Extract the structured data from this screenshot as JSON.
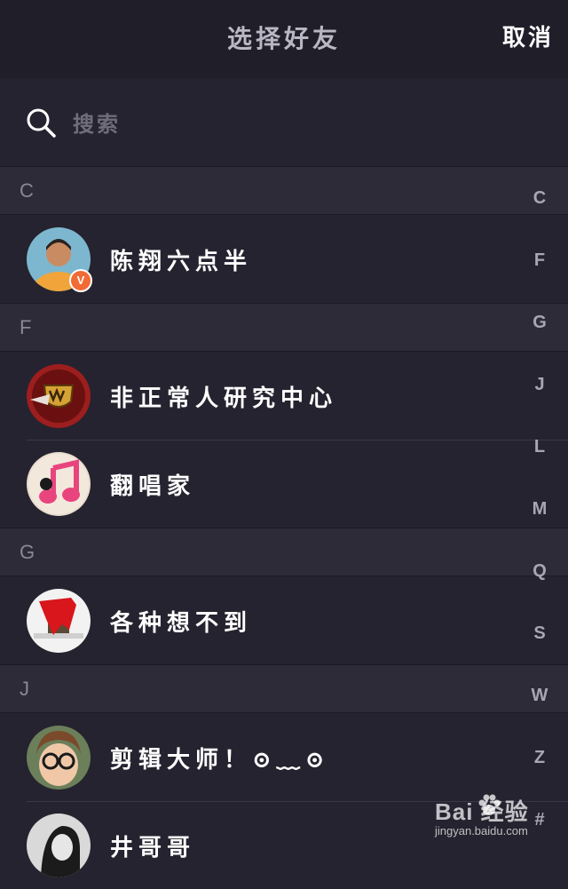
{
  "navbar": {
    "title": "选择好友",
    "cancel_label": "取消"
  },
  "search": {
    "placeholder": "搜索"
  },
  "sections": [
    {
      "letter": "C",
      "contacts": [
        {
          "name": "陈翔六点半",
          "badge": "V"
        }
      ]
    },
    {
      "letter": "F",
      "contacts": [
        {
          "name": "非正常人研究中心"
        },
        {
          "name": "翻唱家"
        }
      ]
    },
    {
      "letter": "G",
      "contacts": [
        {
          "name": "各种想不到"
        }
      ]
    },
    {
      "letter": "J",
      "contacts": [
        {
          "name": "剪辑大师！⊙﹏⊙"
        },
        {
          "name": "井哥哥"
        }
      ]
    }
  ],
  "index_bar": [
    "C",
    "F",
    "G",
    "J",
    "L",
    "M",
    "Q",
    "S",
    "W",
    "Z",
    "#"
  ],
  "watermark": {
    "brand": "Bai  经验",
    "url": "jingyan.baidu.com"
  },
  "colors": {
    "background": "#25232f",
    "navbar": "#1f1e29",
    "section_header": "#2d2b38",
    "badge": "#f26a34"
  }
}
